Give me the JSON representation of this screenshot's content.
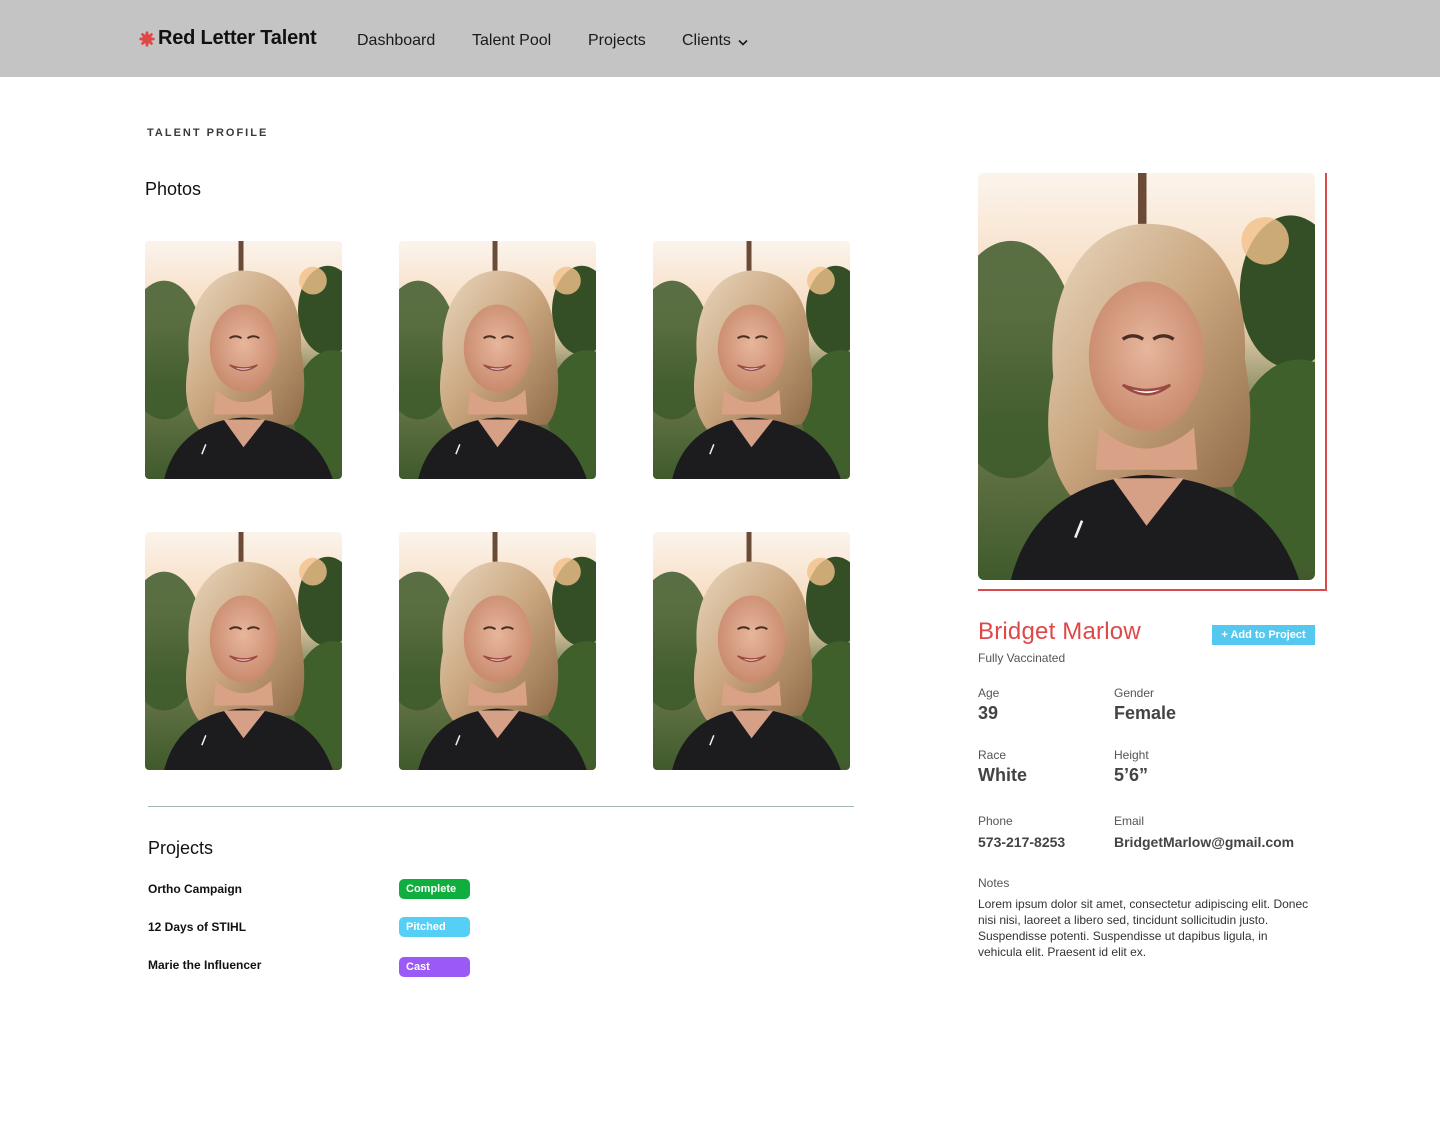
{
  "brand": {
    "name": "Red Letter Talent",
    "icon": "red-asterisk-logo",
    "accent": "#e04848"
  },
  "nav": {
    "items": [
      {
        "label": "Dashboard"
      },
      {
        "label": "Talent Pool"
      },
      {
        "label": "Projects"
      },
      {
        "label": "Clients",
        "icon": "chevron-down-icon"
      }
    ]
  },
  "page": {
    "eyebrow": "TALENT PROFILE"
  },
  "photos": {
    "title": "Photos",
    "count": 6
  },
  "projects": {
    "title": "Projects",
    "items": [
      {
        "name": "Ortho Campaign",
        "status": "Complete",
        "status_color": "#0fae3e"
      },
      {
        "name": "12 Days of STIHL",
        "status": "Pitched",
        "status_color": "#55cff5"
      },
      {
        "name": "Marie the Influencer",
        "status": "Cast",
        "status_color": "#9b59f5"
      }
    ]
  },
  "profile": {
    "name": "Bridget Marlow",
    "vaccination": "Fully Vaccinated",
    "add_button": "+ Add to Project",
    "fields": {
      "age": {
        "label": "Age",
        "value": "39"
      },
      "gender": {
        "label": "Gender",
        "value": "Female"
      },
      "race": {
        "label": "Race",
        "value": "White"
      },
      "height": {
        "label": "Height",
        "value": "5’6”"
      },
      "phone": {
        "label": "Phone",
        "value": "573-217-8253"
      },
      "email": {
        "label": "Email",
        "value": "BridgetMarlow@gmail.com"
      }
    },
    "notes": {
      "label": "Notes",
      "text": "Lorem ipsum dolor sit amet, consectetur adipiscing elit. Donec nisi nisi, laoreet a libero sed, tincidunt sollicitudin justo. Suspendisse potenti. Suspendisse ut dapibus ligula, in vehicula elit. Praesent id elit ex."
    }
  }
}
